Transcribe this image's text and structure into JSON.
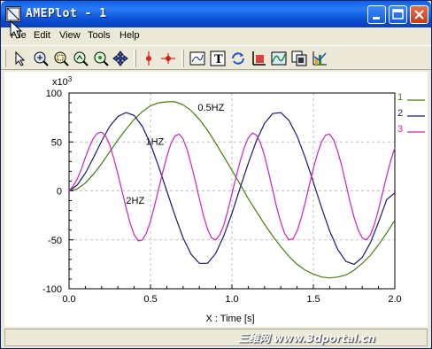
{
  "window": {
    "title": "AMEPlot - 1"
  },
  "menu": {
    "items": [
      "File",
      "Edit",
      "View",
      "Tools",
      "Help"
    ]
  },
  "toolbar": {
    "tools": [
      "select-tool",
      "zoom-tool",
      "zoom-box-tool",
      "zoom-in-tool",
      "zoom-reset-tool",
      "pan-tool",
      "cursor-tool",
      "dual-cursor-tool",
      "plot-window-tool",
      "text-tool",
      "refresh-tool",
      "axes-tool",
      "curve-tool",
      "copy-tool",
      "chart-tool"
    ]
  },
  "watermark": "三维网 www.3dportal.cn",
  "colors": {
    "series1": "#4c7a12",
    "series2": "#1a1a6e",
    "series3": "#cc22bb",
    "grid": "#c0c0c0"
  },
  "chart_data": {
    "type": "line",
    "xlabel": "X : Time [s]",
    "ylabel": "",
    "y_multiplier": "x10^3",
    "y_multiplier_base": "x10",
    "y_multiplier_exp": "3",
    "xlim": [
      0.0,
      2.0
    ],
    "ylim": [
      -100,
      100
    ],
    "x_ticks": [
      "0.0",
      "0.5",
      "1.0",
      "1.5",
      "2.0"
    ],
    "y_ticks": [
      "100",
      "50",
      "0",
      "-50",
      "-100"
    ],
    "grid": true,
    "legend": {
      "position": "right",
      "entries": [
        "1",
        "2",
        "3"
      ]
    },
    "annotations": [
      {
        "text": "0.5HZ",
        "x": 0.79,
        "y": 82
      },
      {
        "text": "1HZ",
        "x": 0.47,
        "y": 47
      },
      {
        "text": "2HZ",
        "x": 0.35,
        "y": -13
      }
    ],
    "series": [
      {
        "name": "1",
        "color": "#4c7a12",
        "x": [
          0,
          0.05,
          0.1,
          0.15,
          0.2,
          0.25,
          0.3,
          0.35,
          0.4,
          0.45,
          0.5,
          0.55,
          0.6,
          0.65,
          0.7,
          0.75,
          0.8,
          0.85,
          0.9,
          0.95,
          1.0,
          1.05,
          1.1,
          1.15,
          1.2,
          1.25,
          1.3,
          1.35,
          1.4,
          1.45,
          1.5,
          1.55,
          1.6,
          1.65,
          1.7,
          1.75,
          1.8,
          1.85,
          1.9,
          1.95,
          2.0
        ],
        "y": [
          0,
          2,
          8,
          17,
          28,
          40,
          52,
          63,
          73,
          81,
          87,
          90,
          91,
          91,
          88,
          82,
          73,
          62,
          49,
          35,
          21,
          7,
          -8,
          -21,
          -34,
          -46,
          -57,
          -67,
          -75,
          -81,
          -85,
          -88,
          -89,
          -88,
          -86,
          -81,
          -74,
          -66,
          -55,
          -43,
          -30
        ]
      },
      {
        "name": "2",
        "color": "#1a1a6e",
        "x": [
          0,
          0.05,
          0.1,
          0.15,
          0.2,
          0.25,
          0.3,
          0.35,
          0.4,
          0.45,
          0.5,
          0.55,
          0.6,
          0.65,
          0.7,
          0.75,
          0.8,
          0.85,
          0.9,
          0.95,
          1.0,
          1.05,
          1.1,
          1.15,
          1.2,
          1.25,
          1.3,
          1.35,
          1.4,
          1.45,
          1.5,
          1.55,
          1.6,
          1.65,
          1.7,
          1.75,
          1.8,
          1.85,
          1.9,
          1.95,
          2.0
        ],
        "y": [
          0,
          6,
          18,
          34,
          51,
          66,
          76,
          80,
          77,
          66,
          48,
          25,
          0,
          -25,
          -48,
          -65,
          -74,
          -74,
          -64,
          -46,
          -23,
          3,
          28,
          51,
          69,
          79,
          80,
          72,
          56,
          34,
          9,
          -17,
          -41,
          -60,
          -72,
          -75,
          -68,
          -53,
          -32,
          -9,
          -2
        ]
      },
      {
        "name": "3",
        "color": "#cc22bb",
        "x": [
          0,
          0.025,
          0.05,
          0.075,
          0.1,
          0.125,
          0.15,
          0.175,
          0.2,
          0.225,
          0.25,
          0.275,
          0.3,
          0.325,
          0.35,
          0.375,
          0.4,
          0.425,
          0.45,
          0.475,
          0.5,
          0.525,
          0.55,
          0.575,
          0.6,
          0.625,
          0.65,
          0.675,
          0.7,
          0.725,
          0.75,
          0.775,
          0.8,
          0.825,
          0.85,
          0.875,
          0.9,
          0.925,
          0.95,
          0.975,
          1.0,
          1.025,
          1.05,
          1.075,
          1.1,
          1.125,
          1.15,
          1.175,
          1.2,
          1.225,
          1.25,
          1.275,
          1.3,
          1.325,
          1.35,
          1.375,
          1.4,
          1.425,
          1.45,
          1.475,
          1.5,
          1.525,
          1.55,
          1.575,
          1.6,
          1.625,
          1.65,
          1.675,
          1.7,
          1.725,
          1.75,
          1.775,
          1.8,
          1.825,
          1.85,
          1.875,
          1.9,
          1.925,
          1.95,
          1.975,
          2.0
        ],
        "y": [
          0,
          5,
          12,
          22,
          34,
          45,
          54,
          59,
          60,
          56,
          47,
          33,
          17,
          0,
          -17,
          -33,
          -45,
          -51,
          -50,
          -43,
          -31,
          -15,
          2,
          19,
          35,
          48,
          56,
          58,
          53,
          42,
          27,
          10,
          -8,
          -25,
          -39,
          -48,
          -50,
          -45,
          -35,
          -20,
          -3,
          14,
          30,
          44,
          54,
          59,
          57,
          49,
          36,
          19,
          1,
          -17,
          -32,
          -44,
          -50,
          -49,
          -41,
          -28,
          -12,
          6,
          23,
          38,
          50,
          57,
          58,
          52,
          40,
          25,
          7,
          -11,
          -27,
          -40,
          -48,
          -50,
          -45,
          -34,
          -19,
          -2,
          15,
          31,
          44
        ]
      }
    ]
  }
}
